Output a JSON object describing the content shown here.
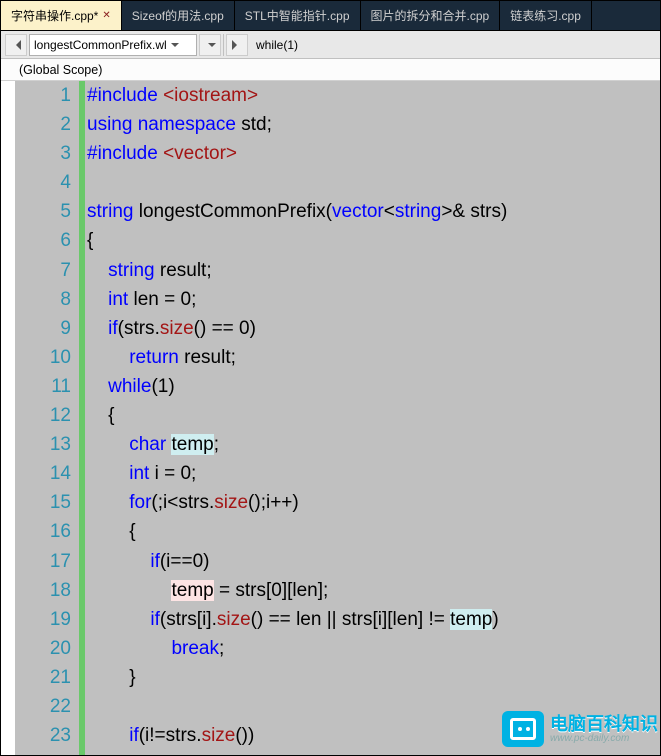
{
  "tabs": [
    {
      "label": "字符串操作.cpp*",
      "active": true
    },
    {
      "label": "Sizeof的用法.cpp",
      "active": false
    },
    {
      "label": "STL中智能指针.cpp",
      "active": false
    },
    {
      "label": "图片的拆分和合并.cpp",
      "active": false
    },
    {
      "label": "链表练习.cpp",
      "active": false
    }
  ],
  "nav": {
    "combo_scope": "longestCommonPrefix.wl",
    "context_item": "while(1)"
  },
  "scope_bar": "(Global Scope)",
  "code": {
    "lines": [
      {
        "n": 1,
        "fold": true,
        "html": "<span class='k'>#include</span> <span class='s'>&lt;iostream&gt;</span>"
      },
      {
        "n": 2,
        "html": "<span class='k'>using namespace</span> <span class='id'>std</span>;"
      },
      {
        "n": 3,
        "html": "<span class='k'>#include</span> <span class='s'>&lt;vector&gt;</span>"
      },
      {
        "n": 4,
        "html": ""
      },
      {
        "n": 5,
        "fold": true,
        "html": "<span class='t'>string</span> <span class='fn'>longestCommonPrefix</span>(<span class='t'>vector</span>&lt;<span class='t'>string</span>&gt;&amp; <span class='id'>strs</span>)"
      },
      {
        "n": 6,
        "html": "{"
      },
      {
        "n": 7,
        "html": "    <span class='t'>string</span> <span class='id'>result</span>;"
      },
      {
        "n": 8,
        "html": "    <span class='t'>int</span> <span class='id'>len</span> = 0;"
      },
      {
        "n": 9,
        "html": "    <span class='k'>if</span>(<span class='id'>strs</span>.<span class='mem'>size</span>() == 0)"
      },
      {
        "n": 10,
        "html": "        <span class='k'>return</span> <span class='id'>result</span>;"
      },
      {
        "n": 11,
        "html": "    <span class='k'>while</span>(1)"
      },
      {
        "n": 12,
        "html": "    <span class='op'>{</span>"
      },
      {
        "n": 13,
        "html": "        <span class='t'>char</span> <span class='hlcyan id'>temp</span>;"
      },
      {
        "n": 14,
        "html": "        <span class='t'>int</span> <span class='id'>i</span> = 0;"
      },
      {
        "n": 15,
        "html": "        <span class='k'>for</span>(;i&lt;<span class='id'>strs</span>.<span class='mem'>size</span>();i++)"
      },
      {
        "n": 16,
        "html": "        {"
      },
      {
        "n": 17,
        "html": "            <span class='k'>if</span>(i==0)"
      },
      {
        "n": 18,
        "html": "                <span class='hlpink id'>temp</span> = <span class='id'>strs</span>[0][<span class='id'>len</span>];"
      },
      {
        "n": 19,
        "html": "            <span class='k'>if</span>(<span class='id'>strs</span>[i].<span class='mem'>size</span>() == <span class='id'>len</span> || <span class='id'>strs</span>[i][<span class='id'>len</span>] != <span class='hlcyan id'>temp</span>)"
      },
      {
        "n": 20,
        "html": "                <span class='k'>break</span>;"
      },
      {
        "n": 21,
        "html": "        }"
      },
      {
        "n": 22,
        "html": ""
      },
      {
        "n": 23,
        "html": "        <span class='k'>if</span>(i!=<span class='id'>strs</span>.<span class='mem'>size</span>())"
      }
    ]
  },
  "watermark": {
    "title": "电脑百科知识",
    "url": "www.pc-daily.com"
  }
}
